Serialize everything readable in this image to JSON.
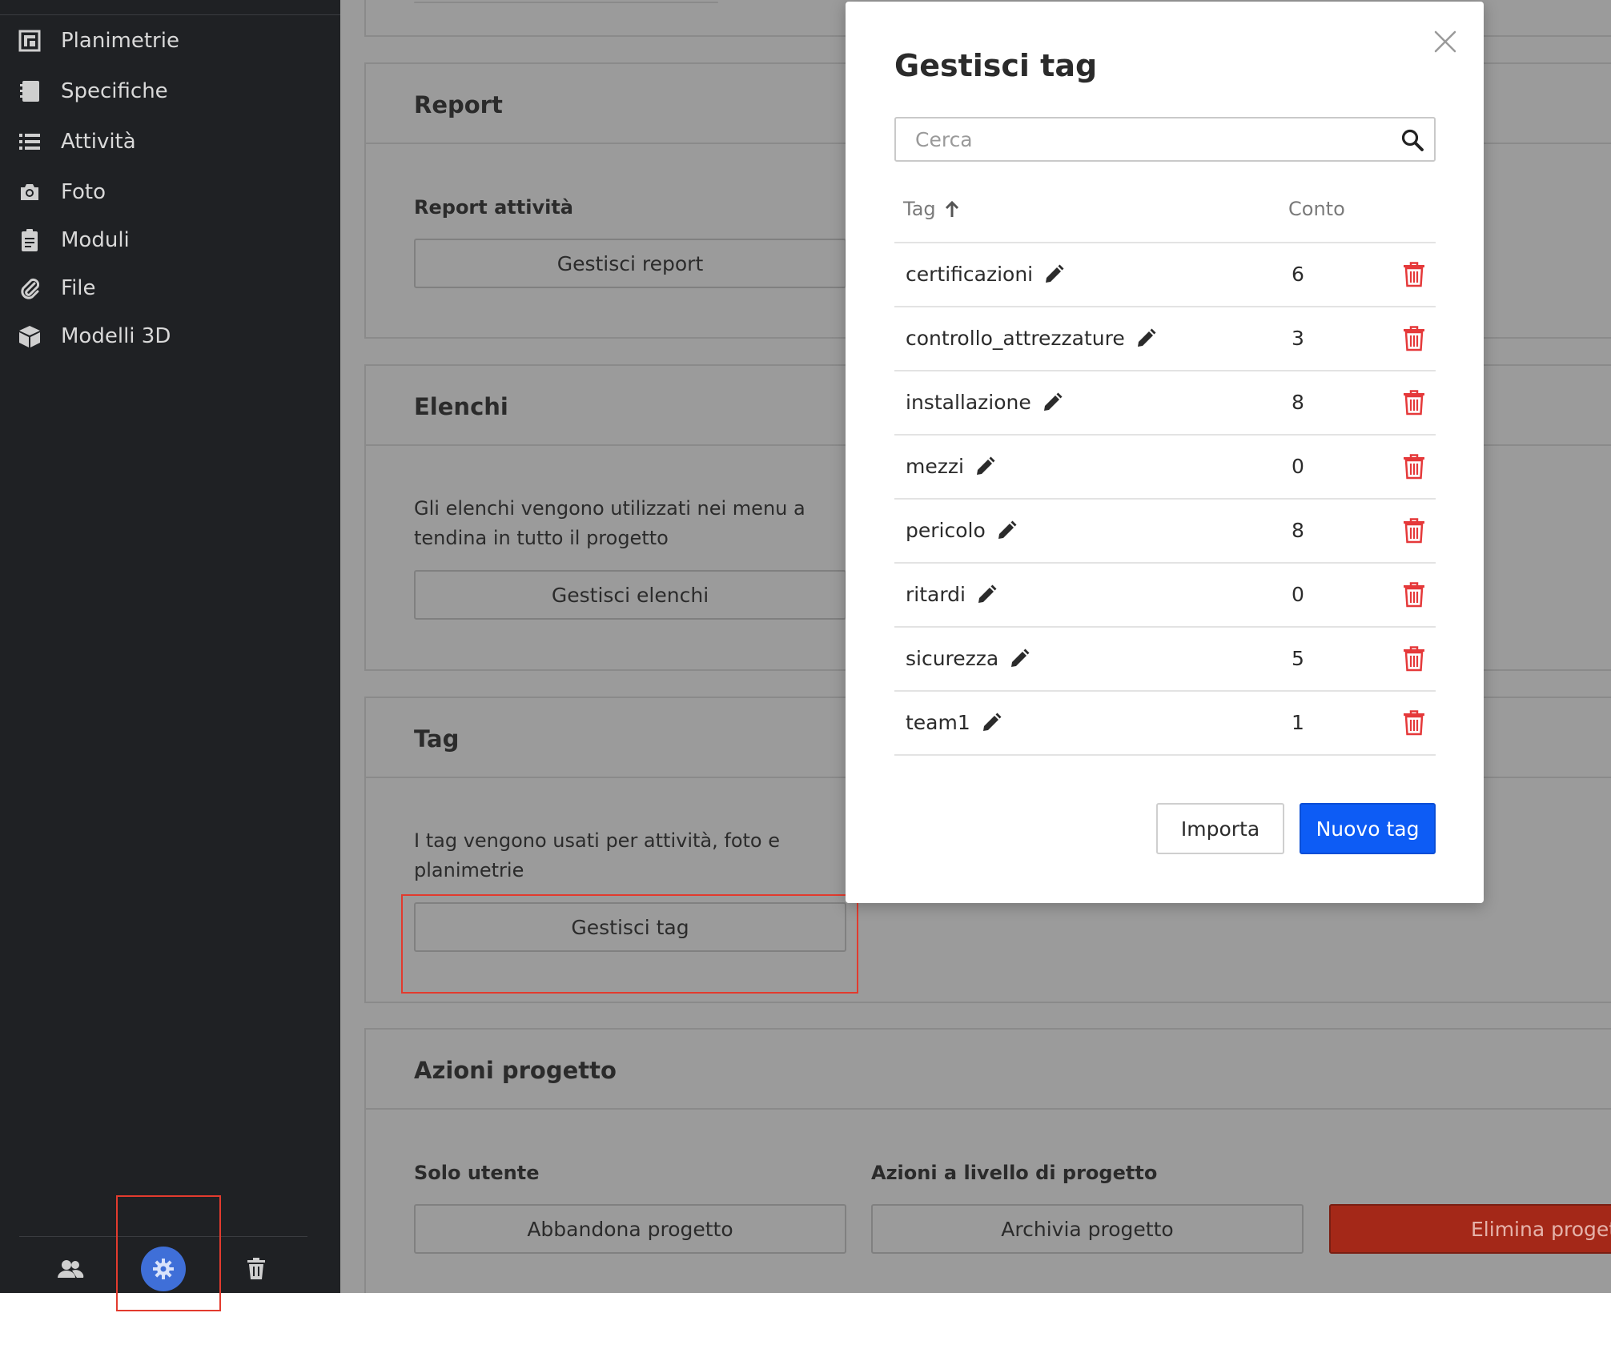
{
  "sidebar": {
    "items": [
      {
        "label": "Planimetrie",
        "icon": "floorplan-icon"
      },
      {
        "label": "Specifiche",
        "icon": "notebook-icon"
      },
      {
        "label": "Attività",
        "icon": "list-icon"
      },
      {
        "label": "Foto",
        "icon": "camera-icon"
      },
      {
        "label": "Moduli",
        "icon": "clipboard-icon"
      },
      {
        "label": "File",
        "icon": "paperclip-icon"
      },
      {
        "label": "Modelli 3D",
        "icon": "cube-icon"
      }
    ],
    "bottom_icons": [
      "users-icon",
      "gear-icon",
      "trash-icon"
    ]
  },
  "main": {
    "report": {
      "title": "Report",
      "subtitle": "Report attività",
      "button": "Gestisci report"
    },
    "lists": {
      "title": "Elenchi",
      "description": "Gli elenchi vengono utilizzati nei menu a tendina in tutto il progetto",
      "button": "Gestisci elenchi"
    },
    "tags": {
      "title": "Tag",
      "description": "I tag vengono usati per attività, foto e planimetrie",
      "button": "Gestisci tag"
    },
    "project_actions": {
      "title": "Azioni progetto",
      "user_only_label": "Solo utente",
      "project_level_label": "Azioni a livello di progetto",
      "leave_button": "Abbandona progetto",
      "archive_button": "Archivia progetto",
      "delete_button": "Elimina progetto"
    }
  },
  "modal": {
    "title": "Gestisci tag",
    "search_placeholder": "Cerca",
    "col_tag": "Tag",
    "col_count": "Conto",
    "rows": [
      {
        "name": "certificazioni",
        "count": "6"
      },
      {
        "name": "controllo_attrezzature",
        "count": "3"
      },
      {
        "name": "installazione",
        "count": "8"
      },
      {
        "name": "mezzi",
        "count": "0"
      },
      {
        "name": "pericolo",
        "count": "8"
      },
      {
        "name": "ritardi",
        "count": "0"
      },
      {
        "name": "sicurezza",
        "count": "5"
      },
      {
        "name": "team1",
        "count": "1"
      }
    ],
    "import_button": "Importa",
    "new_button": "Nuovo tag"
  },
  "colors": {
    "sidebar_bg": "#1f2124",
    "overlay_bg": "#9b9b9b",
    "primary": "#0d5cf5",
    "danger": "#a42818",
    "delete_icon": "#e5393a",
    "highlight": "#e23b2e"
  }
}
